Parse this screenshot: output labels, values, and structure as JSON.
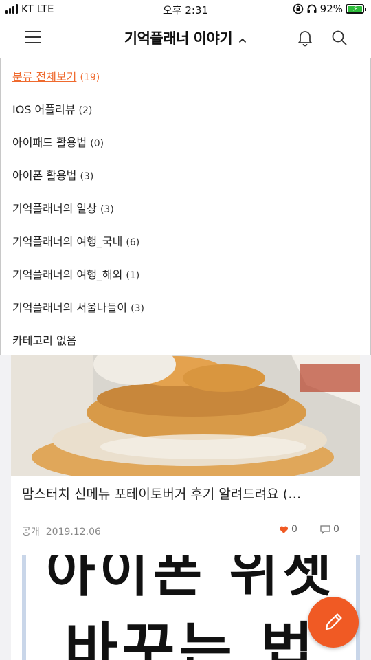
{
  "status_bar": {
    "carrier": "KT LTE",
    "time": "오후 2:31",
    "battery": "92%"
  },
  "header": {
    "title": "기억플래너 이야기"
  },
  "category_menu": {
    "items": [
      {
        "name": "분류 전체보기",
        "count": "(19)",
        "active": true
      },
      {
        "name": "IOS 어플리뷰",
        "count": "(2)"
      },
      {
        "name": "아이패드 활용법",
        "count": "(0)"
      },
      {
        "name": "아이폰 활용법",
        "count": "(3)"
      },
      {
        "name": "기억플래너의 일상",
        "count": "(3)"
      },
      {
        "name": "기억플래너의 여행_국내",
        "count": "(6)"
      },
      {
        "name": "기억플래너의 여행_해외",
        "count": "(1)"
      },
      {
        "name": "기억플래너의 서울나들이",
        "count": "(3)"
      },
      {
        "name": "카테고리 없음",
        "count": ""
      }
    ]
  },
  "posts": [
    {
      "title": "맘스터치  신메뉴 포테이토버거 후기 알려드려요 (…",
      "visibility": "공개",
      "date": "2019.12.06",
      "likes": "0",
      "comments": "0"
    },
    {
      "image_text_line1": "아이폰 위젯",
      "image_text_line2": "바꾸는 법"
    }
  ],
  "colors": {
    "accent": "#f05a24",
    "active_category": "#ef6a2e"
  },
  "icons": {
    "menu": "hamburger-icon",
    "notifications": "bell-icon",
    "search": "search-icon",
    "write": "pencil-icon"
  }
}
